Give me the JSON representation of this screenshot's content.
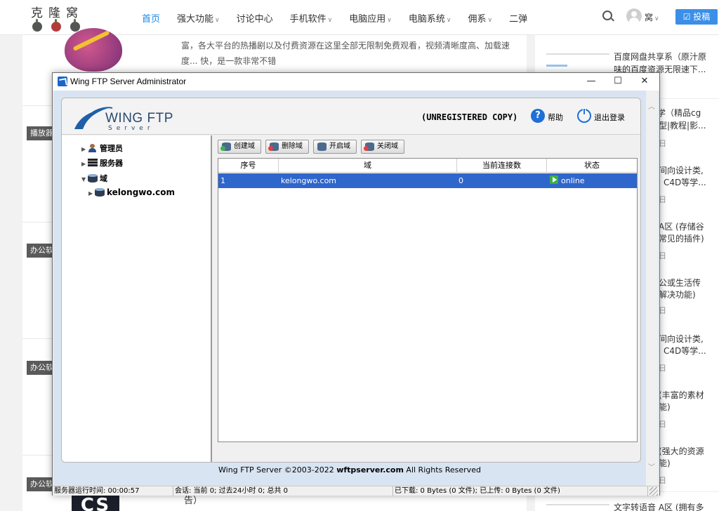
{
  "site": {
    "logo_text": "克隆窝",
    "nav": [
      {
        "label": "首页",
        "active": true,
        "dropdown": false
      },
      {
        "label": "强大功能",
        "active": false,
        "dropdown": true
      },
      {
        "label": "讨论中心",
        "active": false,
        "dropdown": false
      },
      {
        "label": "手机软件",
        "active": false,
        "dropdown": true
      },
      {
        "label": "电脑应用",
        "active": false,
        "dropdown": true
      },
      {
        "label": "电脑系统",
        "active": false,
        "dropdown": true
      },
      {
        "label": "佣系",
        "active": false,
        "dropdown": true
      },
      {
        "label": "二弹",
        "active": false,
        "dropdown": false
      }
    ],
    "user": "窝",
    "post_button": "☑ 投稿",
    "accent": "#1e88e5",
    "snippet": "富，各大平台的热播剧以及付费资源在这里全部无限制免费观看，视频清晰度高、加载速度... 快，是一款非常不错",
    "category_tags": [
      "播放器",
      "办公软",
      "办公软",
      "办公软"
    ],
    "bottom_snippet": "告）",
    "cs_thumb": "CS",
    "sidebar": {
      "first_title": "百度网盘共享系（原汁原味的百度资源无限速下...",
      "fragments": [
        {
          "lines": [
            "学（精品cg",
            "型|教程|影..."
          ],
          "small": "日"
        },
        {
          "lines": [
            "间向设计类,",
            "C4D等学..."
          ],
          "small": "日"
        },
        {
          "lines": [
            "A区 (存储谷",
            "常见的插件)"
          ],
          "small": "日"
        },
        {
          "lines": [
            "公或生活传",
            "解决功能)"
          ],
          "small": "日"
        },
        {
          "lines": [
            "间向设计类,",
            "C4D等学..."
          ],
          "small": "日"
        },
        {
          "lines": [
            "(丰富的素材",
            "能)"
          ],
          "small": "日"
        },
        {
          "lines": [
            "(强大的资源",
            "能)"
          ],
          "small": "日"
        }
      ],
      "last_title": "文字转语音 A区 (拥有多"
    }
  },
  "window": {
    "title": "Wing FTP Server Administrator",
    "controls": {
      "minimize": "—",
      "maximize": "☐",
      "close": "✕"
    },
    "brand": {
      "name": "WING FTP",
      "sub": "Server"
    },
    "unregistered": "(UNREGISTERED COPY)",
    "help_label": "帮助",
    "logout_label": "退出登录",
    "tree": [
      {
        "label": "管理员",
        "icon": "user-icon"
      },
      {
        "label": "服务器",
        "icon": "server-icon"
      },
      {
        "label": "域",
        "icon": "database-icon"
      },
      {
        "label": "kelongwo.com",
        "icon": "domain-icon"
      }
    ],
    "toolbar": [
      {
        "label": "创建域",
        "icon": "create-domain-icon"
      },
      {
        "label": "删除域",
        "icon": "delete-domain-icon"
      },
      {
        "label": "开启域",
        "icon": "start-domain-icon"
      },
      {
        "label": "关闭域",
        "icon": "stop-domain-icon"
      }
    ],
    "grid": {
      "headers": [
        "序号",
        "域",
        "当前连接数",
        "状态"
      ],
      "rows": [
        {
          "id": "1",
          "domain": "kelongwo.com",
          "connections": "0",
          "status": "online"
        }
      ],
      "selection_color": "#2f66cc"
    },
    "copyright_prefix": "Wing FTP Server ©2003-2022 ",
    "copyright_site": "wftpserver.com",
    "copyright_suffix": " All Rights Reserved",
    "statusbar": {
      "uptime": "服务器运行时间: 00:00:57",
      "sessions": "会话: 当前 0;  过去24小时 0;  总共 0",
      "transfer": "已下载: 0 Bytes (0 文件);  已上传: 0 Bytes (0 文件)"
    }
  }
}
